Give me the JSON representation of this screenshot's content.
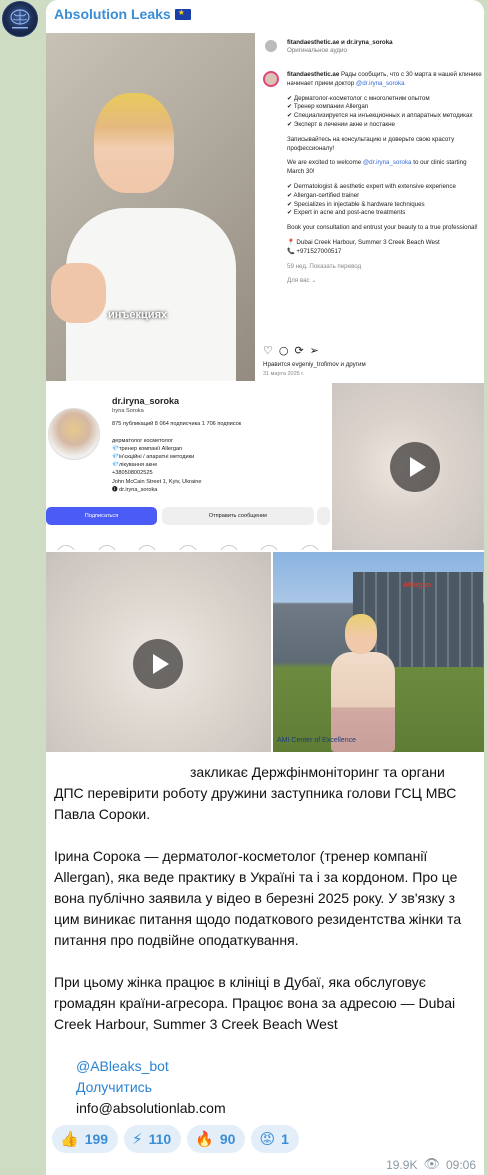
{
  "channel": {
    "name": "Absolution Leaks",
    "avatar_icon": "brain-logo-icon",
    "name_color": "#3a8ed6"
  },
  "media": {
    "tile1_caption": "инъекциях",
    "instagram_post": {
      "header": "fitandaesthetic.ae и dr.iryna_soroka",
      "subheader": "Оригинальное аудио",
      "account": "fitandaesthetic.ae",
      "intro": "Рады сообщить, что с 30 марта в нашей клинике начинает прием доктор",
      "mention": "@dr.iryna_soroka",
      "bullets_ru": [
        "✔ Дерматолог-косметолог с многолетним опытом",
        "✔ Тренер компании Allergan",
        "✔ Специализируется на инъекционных и аппаратных методиках",
        "✔ Эксперт в лечении акне и постакне"
      ],
      "cta_ru": "Записывайтесь на консультацию и доверьте свою красоту профессионалу!",
      "welcome_en_prefix": "We are excited to welcome",
      "welcome_en_suffix": "to our clinic starting March 30!",
      "bullets_en": [
        "✔ Dermatologist & aesthetic expert with extensive experience",
        "✔ Allergan-certified trainer",
        "✔ Specializes in injectable & hardware techniques",
        "✔ Expert in acne and post-acne treatments"
      ],
      "cta_en": "Book your consultation and entrust your beauty to a true professional!",
      "address": "📍 Dubai Creek Harbour, Summer 3 Creek Beach West",
      "phone": "📞 +971527000517",
      "weeks": "59 нед.  Показать перевод",
      "translate": "Для вас ⌄",
      "liked": "Нравится evgeniy_trofimov и другим",
      "date": "31 марта 2025 г."
    },
    "profile": {
      "username": "dr.iryna_soroka",
      "fullname": "Iryna Soroka",
      "stats": "875 публикаций   8 064 подписчика   1 706 подписок",
      "bio": [
        "дерматолог косметолог",
        "💎тренер компанії Allergan",
        "💎ін'єкційні / апаратні методики",
        "💎лікування акне",
        "+380508002525",
        "John McCain Street 1, Kyiv, Ukraine",
        "🅘 dr.iryna_soroka"
      ],
      "follow_button": "Подписаться",
      "message_button": "Отправить сообщение"
    },
    "photo_caption": "AMI Center of Excellence",
    "photo_sign": "Allergan"
  },
  "message": {
    "para1": "закликає Держфінмоніторинг та органи ДПС перевірити роботу дружини заступника голови ГСЦ МВС Павла Сороки.",
    "para2": "Ірина Сорока — дерматолог-косметолог (тренер компанії Allergan), яка веде практику в Україні та і за кордоном. Про це вона публічно заявила у відео в березні 2025 року. У зв'язку з цим виникає питання щодо податкового резидентства жінки та питання про подвійне оподаткування.",
    "para3": "При цьому жінка працює в клініці в Дубаї, яка обслуговує громадян країни-агресора. Працює вона за адресою — Dubai Creek Harbour, Summer 3 Creek Beach West"
  },
  "links": {
    "bot": "@ABleaks_bot",
    "join": "Долучитись",
    "email": "info@absolutionlab.com"
  },
  "reactions": [
    {
      "emoji": "👍",
      "icon": "thumbs-up-icon",
      "count": "199"
    },
    {
      "emoji": "⚡",
      "icon": "lightning-icon",
      "count": "110"
    },
    {
      "emoji": "🔥",
      "icon": "fire-icon",
      "count": "90"
    },
    {
      "emoji": "😡",
      "icon": "angry-face-icon",
      "count": "1"
    }
  ],
  "meta": {
    "views": "19.9K",
    "time": "09:06"
  }
}
